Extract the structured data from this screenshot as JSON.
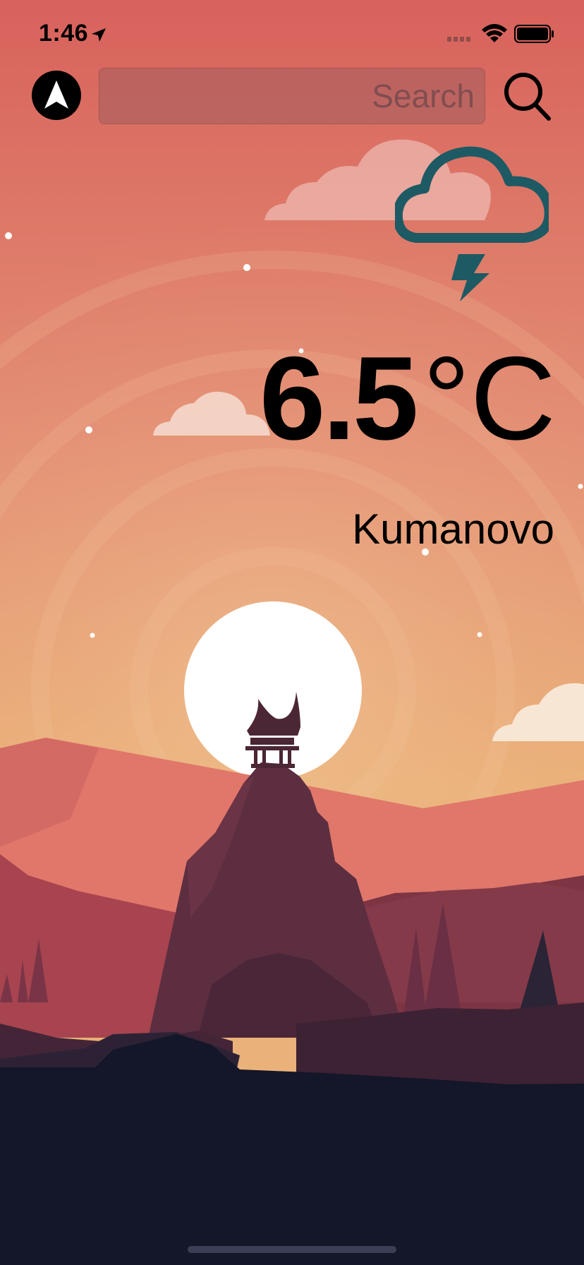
{
  "status_bar": {
    "time": "1:46",
    "icons": [
      "location-arrow-icon",
      "cellular-signal-icon",
      "wifi-icon",
      "battery-icon"
    ]
  },
  "toolbar": {
    "location_icon": "navigation-arrow-icon",
    "search": {
      "placeholder": "Search",
      "value": ""
    },
    "search_icon": "magnifier-icon"
  },
  "weather": {
    "condition_icon": "cloud-lightning-icon",
    "temperature_value": "6.5",
    "temperature_unit": "°C",
    "city": "Kumanovo"
  },
  "colors": {
    "sky_top": "#d8625c",
    "sky_bottom": "#eab378",
    "icon_teal": "#1e5a63",
    "ground": "#141629"
  }
}
